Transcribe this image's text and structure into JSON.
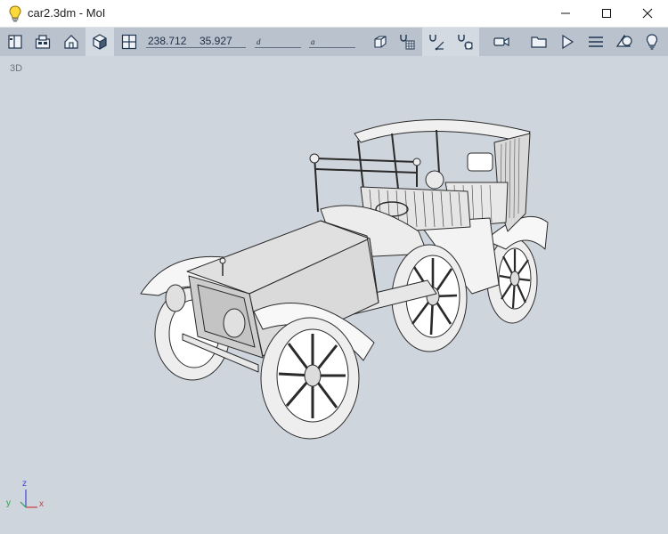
{
  "window": {
    "title": "car2.3dm - MoI",
    "icons": {
      "app": "lightbulb-icon",
      "minimize": "minimize-icon",
      "maximize": "maximize-icon",
      "close": "close-icon"
    }
  },
  "toolbar": {
    "left_icons": [
      "panel-toggle-icon",
      "view-presets-icon",
      "home-view-icon",
      "3d-cube-view-icon",
      "split-view-icon"
    ],
    "coord_x": "238.712",
    "coord_y": "35.927",
    "distance_label": "d",
    "angle_label": "a",
    "right_icons": [
      "box-select-icon",
      "grid-snap-icon",
      "straight-snap-icon",
      "object-snap-icon",
      "camera-icon",
      "folder-icon",
      "run-icon",
      "menu-icon",
      "shapes-icon",
      "lightbulb-icon"
    ]
  },
  "viewport": {
    "label": "3D",
    "axes": {
      "x": "x",
      "y": "y",
      "z": "z"
    },
    "model": "car-3d-model"
  }
}
